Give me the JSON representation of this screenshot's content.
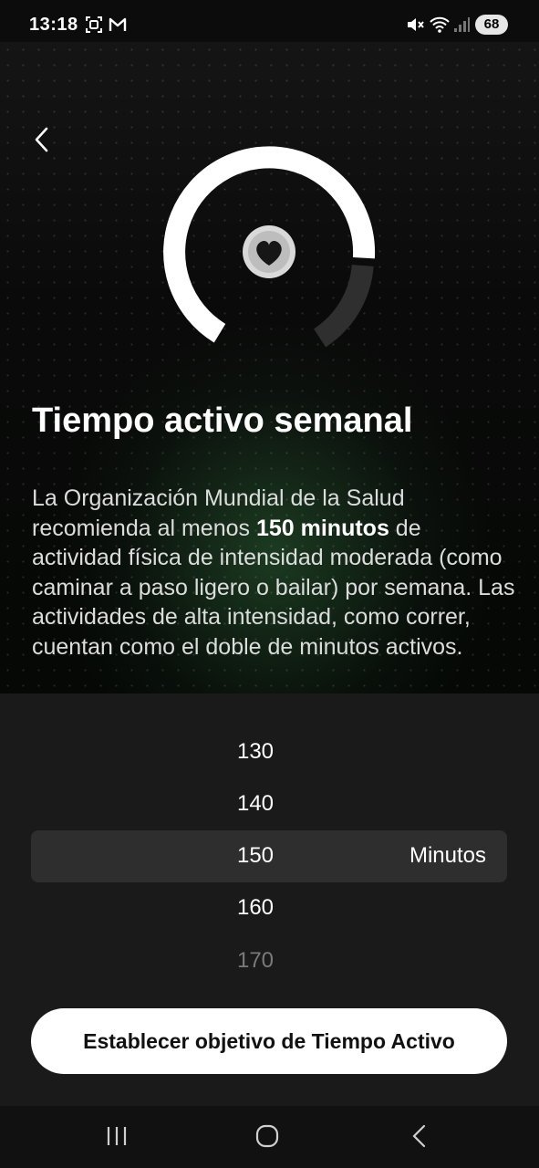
{
  "status_bar": {
    "time": "13:18",
    "battery": "68",
    "icons": [
      "screenshot-icon",
      "gmail-icon",
      "mute-icon",
      "wifi-icon",
      "signal-icon"
    ]
  },
  "hero": {
    "back_icon": "chevron-left-icon",
    "center_icon": "heart-icon",
    "title": "Tiempo activo semanal",
    "description": {
      "before": "La Organización Mundial de la Salud recomienda al menos ",
      "bold": "150 minutos",
      "after": " de actividad física de intensidad moderada (como caminar a paso ligero o bailar) por semana. Las actividades de alta intensidad, como correr, cuentan como el doble de minutos activos."
    }
  },
  "picker": {
    "values": [
      "130",
      "140",
      "150",
      "160",
      "170"
    ],
    "selected": "150",
    "unit": "Minutos"
  },
  "cta": {
    "label": "Establecer objetivo de Tiempo Activo"
  },
  "nav_bar": {
    "icons": [
      "recents-icon",
      "home-icon",
      "back-icon"
    ]
  },
  "colors": {
    "background": "#000000",
    "sheet": "#1a1a1a",
    "highlight": "#2e2e2e",
    "accent_glow": "#2d6437",
    "button": "#ffffff"
  }
}
